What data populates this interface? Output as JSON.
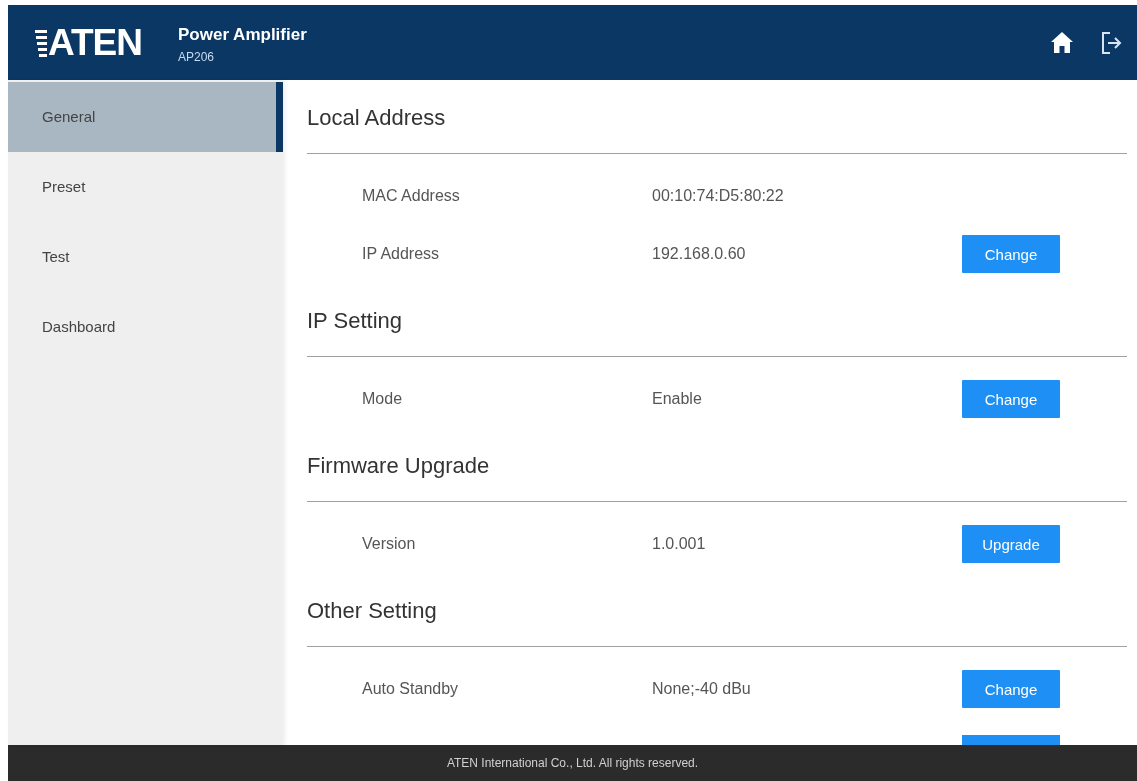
{
  "header": {
    "logo": "ATEN",
    "title": "Power Amplifier",
    "model": "AP206",
    "actions": [
      {
        "kind": "home"
      },
      {
        "kind": "logout"
      }
    ]
  },
  "sidebar": {
    "items": [
      {
        "label": "General",
        "selected": true
      },
      {
        "label": "Preset",
        "selected": false
      },
      {
        "label": "Test",
        "selected": false
      },
      {
        "label": "Dashboard",
        "selected": false
      }
    ]
  },
  "sections": [
    {
      "title": "Local Address",
      "rows": [
        {
          "label": "MAC Address",
          "value": "00:10:74:D5:80:22"
        },
        {
          "label": "IP Address",
          "value": "192.168.0.60",
          "button": "Change"
        }
      ]
    },
    {
      "title": "IP Setting",
      "rows": [
        {
          "label": "Mode",
          "value": "Enable",
          "button": "Change"
        }
      ]
    },
    {
      "title": "Firmware Upgrade",
      "rows": [
        {
          "label": "Version",
          "value": "1.0.001",
          "button": "Upgrade"
        }
      ]
    },
    {
      "title": "Other Setting",
      "rows": [
        {
          "label": "Auto Standby",
          "value": "None;-40 dBu",
          "button": "Change"
        }
      ],
      "more_below": true
    }
  ],
  "footer": "ATEN International Co., Ltd. All rights reserved."
}
